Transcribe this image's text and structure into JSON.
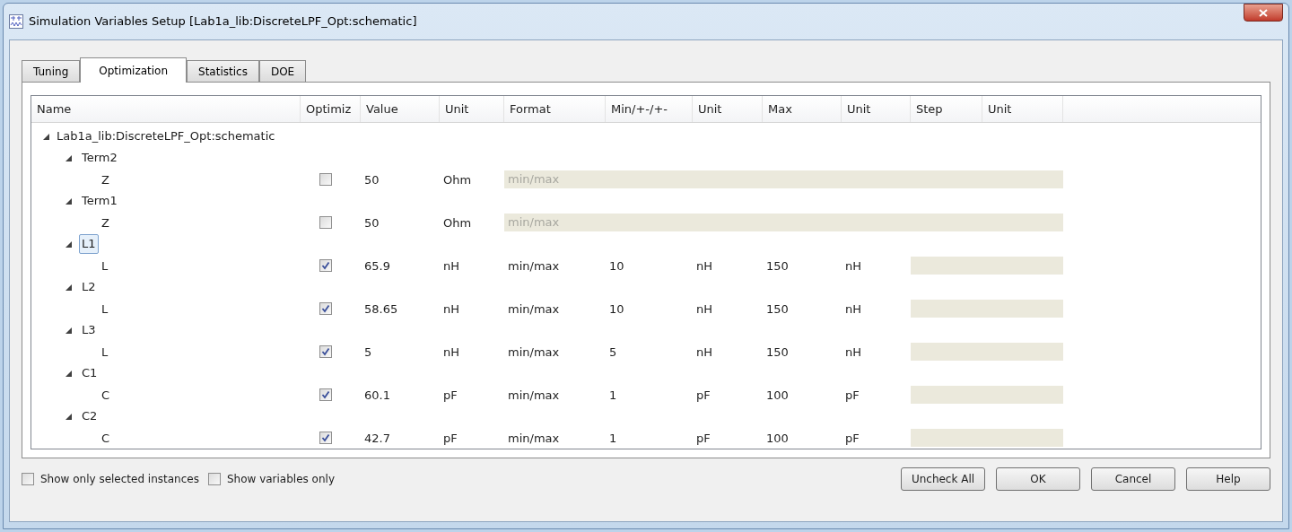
{
  "window": {
    "title": "Simulation Variables Setup [Lab1a_lib:DiscreteLPF_Opt:schematic]"
  },
  "tabs": [
    {
      "label": "Tuning",
      "selected": false
    },
    {
      "label": "Optimization",
      "selected": true
    },
    {
      "label": "Statistics",
      "selected": false
    },
    {
      "label": "DOE",
      "selected": false
    }
  ],
  "table": {
    "columns": [
      "Name",
      "Optimiz",
      "Value",
      "Unit",
      "Format",
      "Min/+-/+-",
      "Unit",
      "Max",
      "Unit",
      "Step",
      "Unit"
    ],
    "tree": {
      "label": "Lab1a_lib:DiscreteLPF_Opt:schematic",
      "expanded": true,
      "children": [
        {
          "label": "Term2",
          "expanded": true,
          "selected": false,
          "children": [
            {
              "name": "Z",
              "optimize": false,
              "value": "50",
              "unit": "Ohm",
              "format": "min/max"
            }
          ]
        },
        {
          "label": "Term1",
          "expanded": true,
          "selected": false,
          "children": [
            {
              "name": "Z",
              "optimize": false,
              "value": "50",
              "unit": "Ohm",
              "format": "min/max"
            }
          ]
        },
        {
          "label": "L1",
          "expanded": true,
          "selected": true,
          "children": [
            {
              "name": "L",
              "optimize": true,
              "value": "65.9",
              "unit": "nH",
              "format": "min/max",
              "min": "10",
              "min_unit": "nH",
              "max": "150",
              "max_unit": "nH"
            }
          ]
        },
        {
          "label": "L2",
          "expanded": true,
          "selected": false,
          "children": [
            {
              "name": "L",
              "optimize": true,
              "value": "58.65",
              "unit": "nH",
              "format": "min/max",
              "min": "10",
              "min_unit": "nH",
              "max": "150",
              "max_unit": "nH"
            }
          ]
        },
        {
          "label": "L3",
          "expanded": true,
          "selected": false,
          "children": [
            {
              "name": "L",
              "optimize": true,
              "value": "5",
              "unit": "nH",
              "format": "min/max",
              "min": "5",
              "min_unit": "nH",
              "max": "150",
              "max_unit": "nH"
            }
          ]
        },
        {
          "label": "C1",
          "expanded": true,
          "selected": false,
          "children": [
            {
              "name": "C",
              "optimize": true,
              "value": "60.1",
              "unit": "pF",
              "format": "min/max",
              "min": "1",
              "min_unit": "pF",
              "max": "100",
              "max_unit": "pF"
            }
          ]
        },
        {
          "label": "C2",
          "expanded": true,
          "selected": false,
          "children": [
            {
              "name": "C",
              "optimize": true,
              "value": "42.7",
              "unit": "pF",
              "format": "min/max",
              "min": "1",
              "min_unit": "pF",
              "max": "100",
              "max_unit": "pF"
            }
          ]
        }
      ]
    }
  },
  "options": [
    {
      "label": "Show only selected instances",
      "checked": false
    },
    {
      "label": "Show variables only",
      "checked": false
    }
  ],
  "buttons": [
    "Uncheck All",
    "OK",
    "Cancel",
    "Help"
  ]
}
